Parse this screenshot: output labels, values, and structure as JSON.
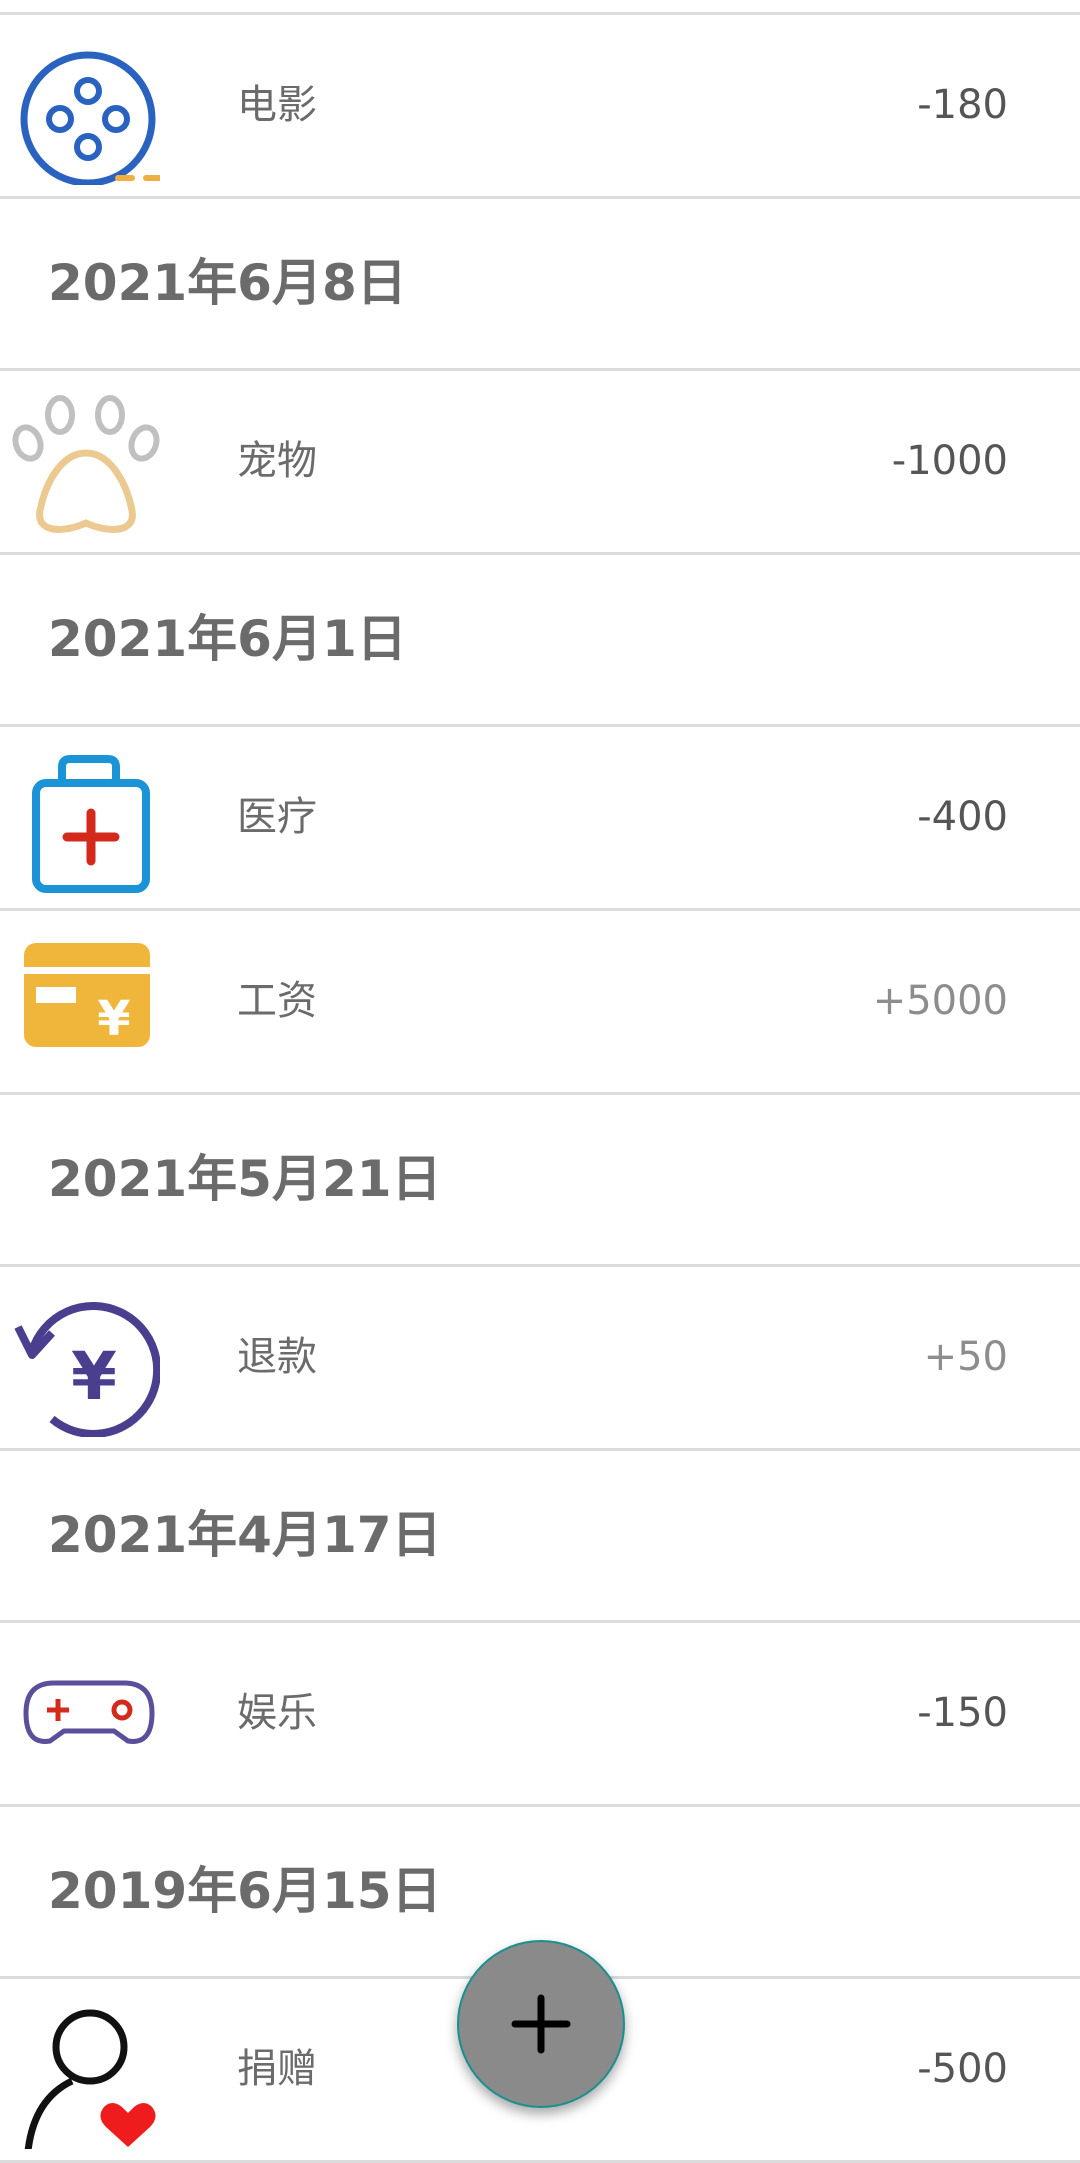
{
  "transactions": [
    {
      "type": "item",
      "category": "电影",
      "amount": "-180",
      "icon": "film-reel-icon"
    },
    {
      "type": "date",
      "date": "2021年6月8日"
    },
    {
      "type": "item",
      "category": "宠物",
      "amount": "-1000",
      "icon": "paw-icon"
    },
    {
      "type": "date",
      "date": "2021年6月1日"
    },
    {
      "type": "item",
      "category": "医疗",
      "amount": "-400",
      "icon": "medical-kit-icon"
    },
    {
      "type": "item",
      "category": "工资",
      "amount": "+5000",
      "icon": "salary-card-icon"
    },
    {
      "type": "date",
      "date": "2021年5月21日"
    },
    {
      "type": "item",
      "category": "退款",
      "amount": "+50",
      "icon": "refund-icon"
    },
    {
      "type": "date",
      "date": "2021年4月17日"
    },
    {
      "type": "item",
      "category": "娱乐",
      "amount": "-150",
      "icon": "gamepad-icon"
    },
    {
      "type": "date",
      "date": "2019年6月15日"
    },
    {
      "type": "item",
      "category": "捐赠",
      "amount": "-500",
      "icon": "donation-icon"
    }
  ],
  "fab": {
    "icon": "plus-icon"
  },
  "colors": {
    "expense_text": "#555555",
    "income_text": "#8d8d8d",
    "divider": "#dcdcdc",
    "fab": "#8a8a8a"
  }
}
